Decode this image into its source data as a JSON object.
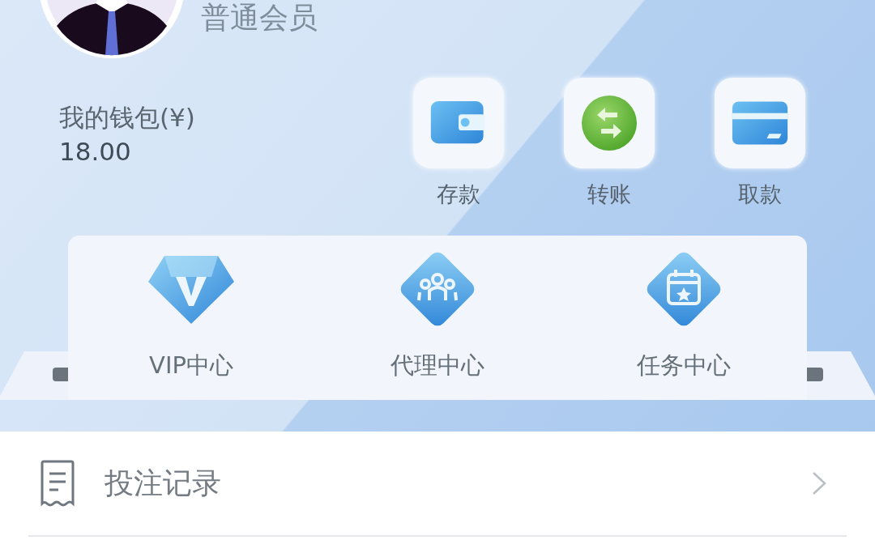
{
  "profile": {
    "member_level": "普通会员"
  },
  "wallet": {
    "label": "我的钱包(¥)",
    "amount": "18.00"
  },
  "actions": [
    {
      "kind": "deposit",
      "label": "存款"
    },
    {
      "kind": "transfer",
      "label": "转账"
    },
    {
      "kind": "withdraw",
      "label": "取款"
    }
  ],
  "centers": [
    {
      "kind": "vip",
      "label": "VIP中心"
    },
    {
      "kind": "agent",
      "label": "代理中心"
    },
    {
      "kind": "task",
      "label": "任务中心"
    }
  ],
  "menu": [
    {
      "kind": "bet_records",
      "label": "投注记录"
    }
  ]
}
